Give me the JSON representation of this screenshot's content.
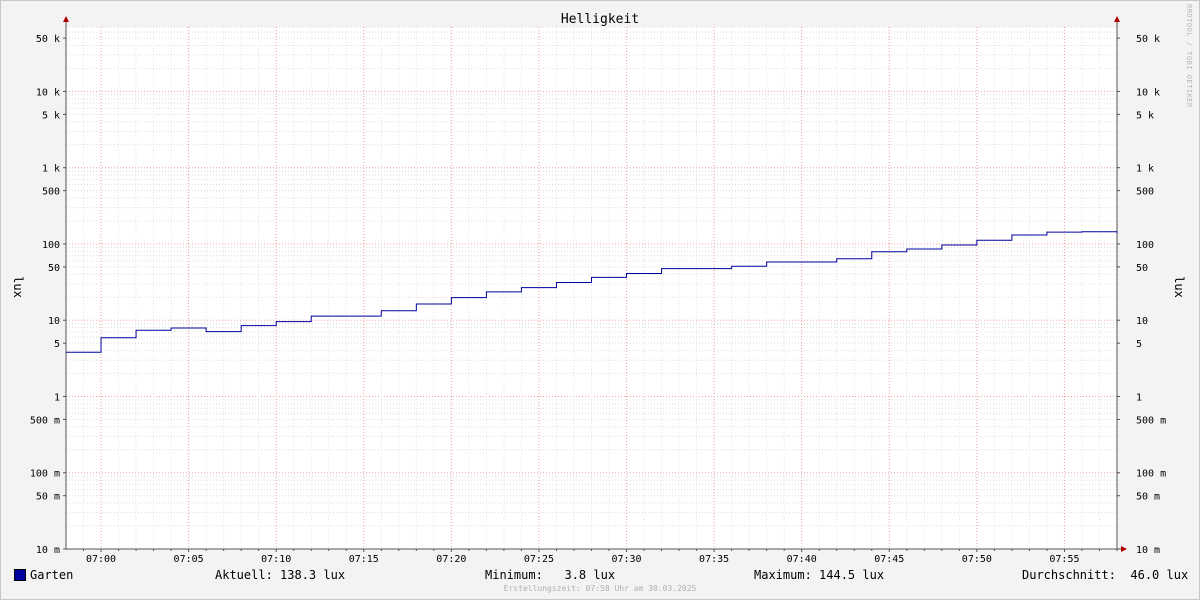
{
  "chart_data": {
    "type": "line",
    "title": "Helligkeit",
    "ylabel": "lux",
    "yscale": "log",
    "ylim": [
      0.01,
      70000
    ],
    "y_tick_labels": [
      {
        "value": 50000,
        "label": "50 k"
      },
      {
        "value": 10000,
        "label": "10 k"
      },
      {
        "value": 5000,
        "label": "5 k"
      },
      {
        "value": 1000,
        "label": "1 k"
      },
      {
        "value": 500,
        "label": "500"
      },
      {
        "value": 100,
        "label": "100"
      },
      {
        "value": 50,
        "label": "50"
      },
      {
        "value": 10,
        "label": "10"
      },
      {
        "value": 5,
        "label": "5"
      },
      {
        "value": 1,
        "label": "1"
      },
      {
        "value": 0.5,
        "label": "500 m"
      },
      {
        "value": 0.1,
        "label": "100 m"
      },
      {
        "value": 0.05,
        "label": "50 m"
      },
      {
        "value": 0.01,
        "label": "10 m"
      }
    ],
    "x_tick_labels": [
      "07:00",
      "07:05",
      "07:10",
      "07:15",
      "07:20",
      "07:25",
      "07:30",
      "07:35",
      "07:40",
      "07:45",
      "07:50",
      "07:55"
    ],
    "xlim": [
      "06:58",
      "07:58"
    ],
    "series": [
      {
        "name": "Garten",
        "color": "#0000a0",
        "step": true,
        "x": [
          "06:58",
          "07:00",
          "07:02",
          "07:04",
          "07:06",
          "07:08",
          "07:10",
          "07:12",
          "07:16",
          "07:18",
          "07:20",
          "07:22",
          "07:24",
          "07:26",
          "07:28",
          "07:30",
          "07:32",
          "07:36",
          "07:38",
          "07:42",
          "07:44",
          "07:46",
          "07:48",
          "07:50",
          "07:52",
          "07:54",
          "07:56",
          "07:58"
        ],
        "values": [
          3.8,
          5.9,
          7.4,
          7.9,
          7.1,
          8.5,
          9.6,
          11.3,
          13.3,
          16.3,
          19.8,
          23.5,
          26.8,
          31.2,
          36.5,
          41,
          47.5,
          51,
          58,
          64,
          79,
          86,
          97,
          112,
          131,
          143,
          144.5,
          138.3
        ]
      }
    ]
  },
  "legend": {
    "series_name": "Garten",
    "current": "Aktuell: 138.3 lux",
    "minimum": "Minimum:   3.8 lux",
    "maximum": "Maximum: 144.5 lux",
    "average": "Durchschnitt:  46.0 lux"
  },
  "footer": "Erstellungszeit: 07:58 Uhr am 30.03.2025",
  "watermark": "RRDTOOL / TOBI OETIKER"
}
